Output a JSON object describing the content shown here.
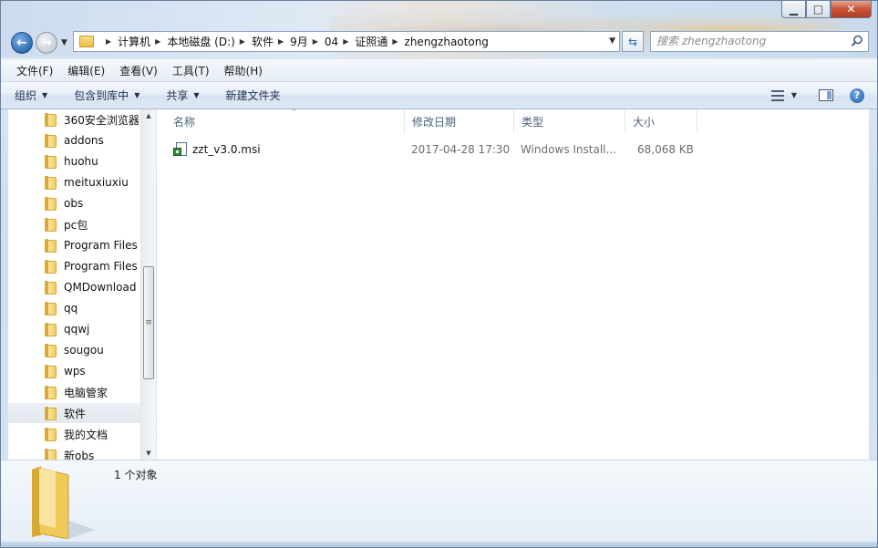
{
  "window": {
    "buttons": {
      "minimize": "▁",
      "maximize": "□",
      "close": "✕"
    }
  },
  "address": {
    "crumbs": [
      "计算机",
      "本地磁盘 (D:)",
      "软件",
      "9月",
      "04",
      "证照通",
      "zhengzhaotong"
    ]
  },
  "search": {
    "placeholder": "搜索 zhengzhaotong"
  },
  "menu": [
    "文件(F)",
    "编辑(E)",
    "查看(V)",
    "工具(T)",
    "帮助(H)"
  ],
  "toolbar": {
    "organize": "组织",
    "include_library": "包含到库中",
    "share": "共享",
    "new_folder": "新建文件夹"
  },
  "nav": {
    "items": [
      "360安全浏览器",
      "addons",
      "huohu",
      "meituxiuxiu",
      "obs",
      "pc包",
      "Program Files",
      "Program Files",
      "QMDownload",
      "qq",
      "qqwj",
      "sougou",
      "wps",
      "电脑管家",
      "软件",
      "我的文档",
      "新obs"
    ],
    "selected": "软件"
  },
  "columns": {
    "name": "名称",
    "modified": "修改日期",
    "type": "类型",
    "size": "大小"
  },
  "files": [
    {
      "name": "zzt_v3.0.msi",
      "modified": "2017-04-28 17:30",
      "type": "Windows Install...",
      "size": "68,068 KB"
    }
  ],
  "status": {
    "count": "1 个对象"
  },
  "colors": {
    "accent": "#2e6bb5",
    "folder": "#f1cc5c",
    "close": "#c7553b"
  }
}
